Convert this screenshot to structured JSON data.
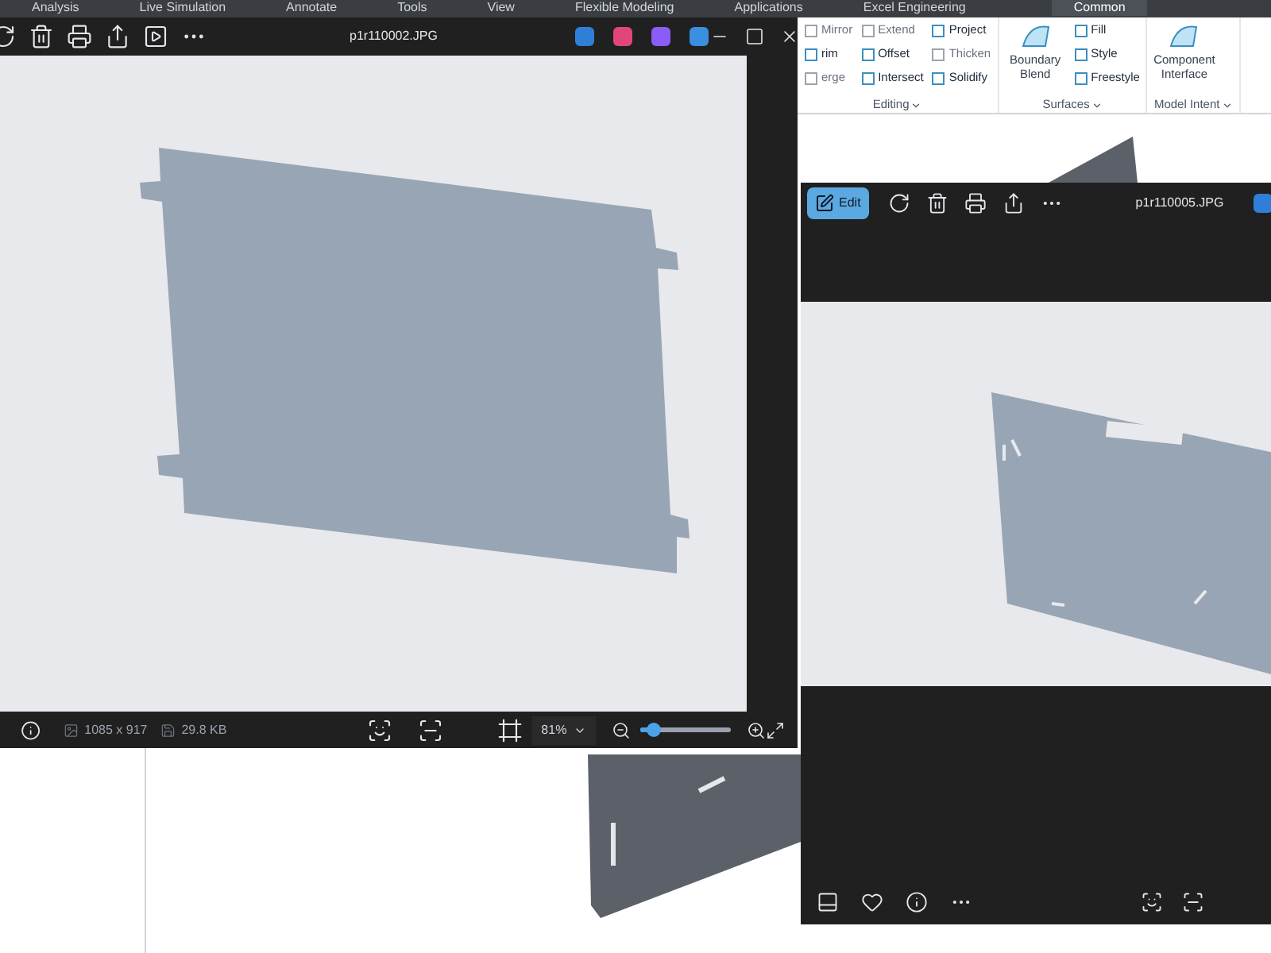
{
  "cad_app": {
    "menu_tabs": [
      {
        "label": "Analysis",
        "selected": false
      },
      {
        "label": "Live Simulation",
        "selected": false
      },
      {
        "label": "Annotate",
        "selected": false
      },
      {
        "label": "Tools",
        "selected": false
      },
      {
        "label": "View",
        "selected": false
      },
      {
        "label": "Flexible Modeling",
        "selected": false
      },
      {
        "label": "Applications",
        "selected": false
      },
      {
        "label": "Excel Engineering",
        "selected": false
      },
      {
        "label": "Common",
        "selected": true
      }
    ],
    "ribbon_groups": [
      {
        "label": "Editing",
        "columns": [
          [
            {
              "label": "Mirror",
              "disabled": true
            },
            {
              "label": "rim",
              "disabled": false
            },
            {
              "label": "erge",
              "disabled": true
            }
          ],
          [
            {
              "label": "Extend",
              "disabled": true
            },
            {
              "label": "Offset",
              "disabled": false
            },
            {
              "label": "Intersect",
              "disabled": false
            }
          ],
          [
            {
              "label": "Project",
              "disabled": false
            },
            {
              "label": "Thicken",
              "disabled": true
            },
            {
              "label": "Solidify",
              "disabled": false
            }
          ]
        ]
      },
      {
        "label": "Surfaces",
        "large": {
          "label": "Boundary Blend"
        },
        "columns": [
          [
            {
              "label": "Fill",
              "disabled": false
            },
            {
              "label": "Style",
              "disabled": false
            },
            {
              "label": "Freestyle",
              "disabled": false
            }
          ]
        ]
      },
      {
        "label": "Model Intent",
        "large": {
          "label": "Component Interface"
        }
      }
    ]
  },
  "photo_window_1": {
    "title": "p1r110002.JPG",
    "dimensions": "1085 x 917",
    "file_size": "29.8 KB",
    "zoom": "81%",
    "zoom_slider": {
      "level": 0.13
    }
  },
  "photo_window_2": {
    "title": "p1r110005.JPG",
    "edit_button": {
      "label": "Edit",
      "selected": true
    }
  }
}
